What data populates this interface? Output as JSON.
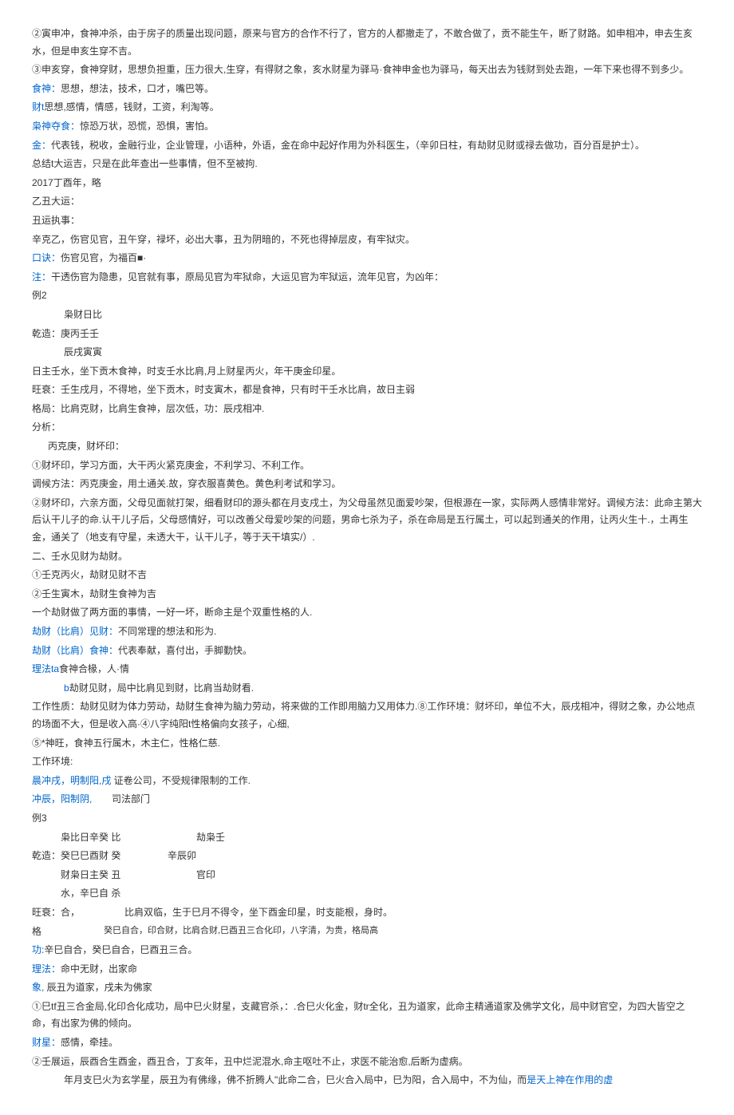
{
  "p1": "②寅申冲，食神冲杀，由于房子的质量出现问题，原来与官方的合作不行了，官方的人都撤走了，不敢合做了，贡不能生午，断了财路。如申相冲，申去生亥水，但是申亥生穿不吉。",
  "p2": "③申亥穿，食神穿财，思想负担重，压力很大,生穿，有得财之象，亥水财星为驿马·食神申金也为驿马，每天出去为钱财到处去跑，一年下来也得不到多少。",
  "p3a": "食神：",
  "p3b": "思想，想法，技术，口才，嘴巴等。",
  "p4a": "财t",
  "p4b": "思想,感情，情感，钱财，工资，利淘等。",
  "p5a": "枭神夺食：",
  "p5b": "惊恐万状，恐慌，恐惧，害怕。",
  "p6a": "金：",
  "p6b": "代表钱，税收，金融行业，企业管理，小语种，外语，金在命中起好作用为外科医生，（辛卯日柱，有劫财见财或禄去做功，百分百是护士）。",
  "p7": "总结t大运吉，只是在此年查出一些事情，但不至被拘.",
  "p8": "2017丁酉年，略",
  "p9": "乙丑大运：",
  "p10": "丑运执事：",
  "p11": "辛克乙，伤官见官，丑午穿，禄坏，必出大事，丑为阴暗的，不死也得掉层皮，有牢狱灾。",
  "p12a": "口诀：",
  "p12b": "伤官见官，为福百■·",
  "p13a": "注：",
  "p13b": "干透伤官为隐患，见官就有事，原局见官为牢狱命，大运见官为牢狱运，流年见官，为凶年：",
  "p14": "例2",
  "p15": "枭财日比",
  "p16": "乾造：庚丙壬壬",
  "p17": "辰戌寅寅",
  "p18": "日主壬水，坐下贡木食神，时支壬水比肩,月上财星丙火，年干庚金印星。",
  "p19": "旺衰：壬生戌月，不得地，坐下贡木，时支寅木，都是食神，只有时干壬水比肩，故日主弱",
  "p20": "格局：比肩克财，比肩生食神，层次低，功：辰戌相冲.",
  "p21": "分析：",
  "p22": "丙克庚，财坏印：",
  "p23": "①财坏印，学习方面，大干丙火紧克庚金，不利学习、不利工作。",
  "p24": "调候方法：丙克庚金，用土通关.故，穿衣服喜黄色。黄色利考试和学习。",
  "p25": "②财坏印，六亲方面，父母见面就打架，细看财印的源头都在月支戌土，为父母虽然见面爱吵架，但根源在一家，实际两人感情非常好。调候方法：此命主第大后认干儿子的命.认干儿子后，父母感情好，可以改善父母爱吵架的问题，男命七杀为子，杀在命局是五行属土，可以起到通关的作用，让丙火生十.，土再生金，通关了（地支有守星，未透大干，认干儿子，等于天干填实/）.",
  "p26": "二、壬水见财为劫财。",
  "p27": "①壬克丙火，劫财见财不吉",
  "p28": "②壬生寅木，劫财生食神为吉",
  "p29": "一个劫财做了两方面的事情，一好一坏，断命主是个双重性格的人.",
  "p30a": "劫财（比肩）见财：",
  "p30b": "不同常理的想法和形为.",
  "p31a": "劫财（比肩）食神：",
  "p31b": "代表奉献，喜付出，手脚勤快。",
  "p32a": "理法ta",
  "p32b": "食神合椽，人·情",
  "p33a": "b",
  "p33b": "劫财见财，局中比肩见到财，比肩当劫财看.",
  "p34": "工作性质：劫财见财为体力劳动，劫财生食神为脑力劳动，将来做的工作即用脑力又用体力.⑧工作环境：财坏印，单位不大，辰戌相冲，得财之象，办公地点的场面不大，但是收入高·④八字纯阳t性格偏向女孩子，心细,",
  "p35": "⑤*神旺，食神五行属木，木主仁，性格仁慈.",
  "p36": "工作环境:",
  "p37a": "晨冲戌，明制阳,戌",
  "p37b": " 证卷公司，不受规律限制的工作.",
  "p38a": "冲辰，阳制阴,",
  "p38b": "司法部门",
  "p39": "例3",
  "r1a": "枭比日辛癸 比",
  "r1b": "劫枭壬",
  "r2a": "乾造：",
  "r2b": "癸巳巳酉财 癸",
  "r2c": "辛辰卯",
  "r3a": "财枭日主癸 丑",
  "r3b": "官印",
  "r4": "水，辛巳自 杀",
  "r5a": "旺衰：",
  "r5b": "合，",
  "r5c": "比肩双临，生于巳月不得令，坐下酉金印星，时支能根，身时。",
  "r6a": "格",
  "r6b": "癸巳自合，印合财，比肩合财,巳酉丑三合化印，八字清，为贵，格局高",
  "r7a": "功:",
  "r7b": "辛巳自合，癸巳自合，巳酉丑三合。",
  "p40a": "理法：",
  "p40b": "命中无财，出家命",
  "p41a": "象,",
  "p41b": " 辰丑为道家，戌未为佛家",
  "p42": "①巳tf丑三合金局,化印合化成功，局中巳火财星，支藏官杀，：.合巳火化金，财tr全化，丑为道家，此命主精通道家及佛学文化，局中财官空，为四大皆空之命，有出家为佛的倾向。",
  "p43a": "财星：",
  "p43b": "感情，牵挂。",
  "p44": "②壬展运，辰酉合生酉金，酉丑合，丁亥年，丑中烂泥混水,命主呕吐不止，求医不能治愈,后断为虚病。",
  "p45a": "年月支巳火为玄学星，辰丑为有佛缘，佛不折腾人\"此命二合，巳火合入局中，巳为阳，合入局中，不为仙，而",
  "p45b": "是天上神在作用的虚"
}
